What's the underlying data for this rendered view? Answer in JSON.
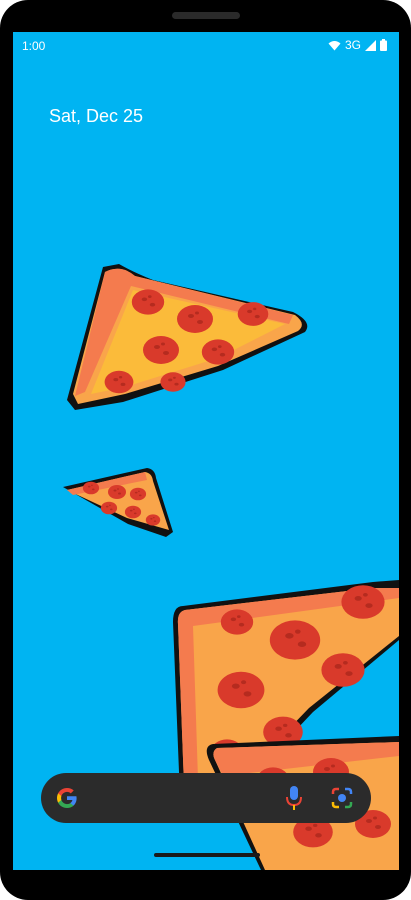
{
  "status_bar": {
    "time": "1:00",
    "network": "3G"
  },
  "home": {
    "date": "Sat, Dec 25"
  },
  "search_widget": {
    "g_icon": "google-g-icon",
    "mic_icon": "mic-icon",
    "lens_icon": "lens-icon"
  },
  "wallpaper": {
    "background_color": "#00b4f2",
    "subject": "pizza-slice-icon"
  }
}
